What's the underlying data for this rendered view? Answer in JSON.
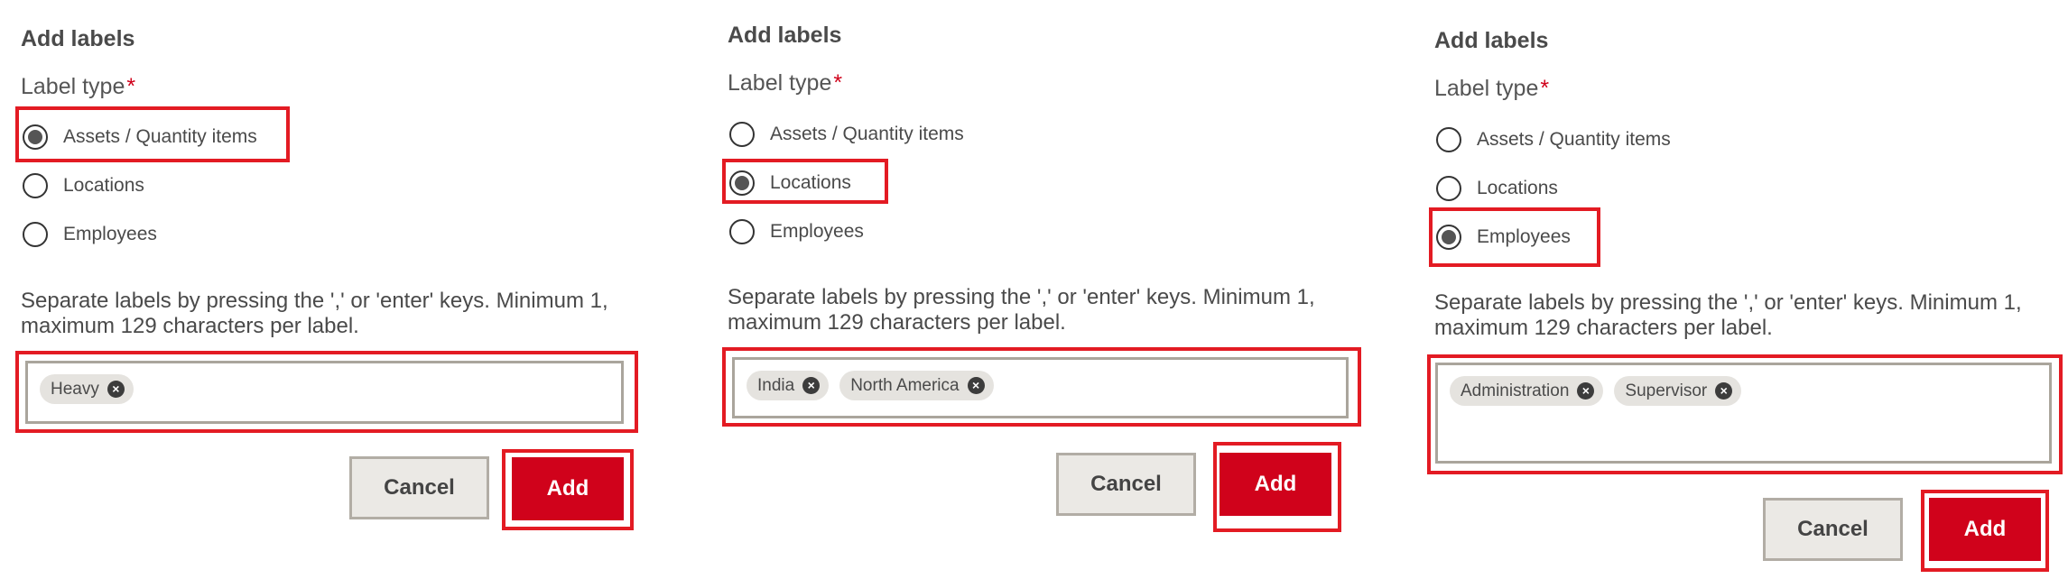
{
  "panels": [
    {
      "title": "Add labels",
      "label_type": "Label type",
      "required_mark": "*",
      "options": [
        "Assets / Quantity items",
        "Locations",
        "Employees"
      ],
      "selected": 0,
      "help": "Separate labels by pressing the ',' or 'enter' keys. Minimum 1, maximum 129 characters per label.",
      "chips": [
        "Heavy"
      ],
      "cancel": "Cancel",
      "add": "Add"
    },
    {
      "title": "Add labels",
      "label_type": "Label type",
      "required_mark": "*",
      "options": [
        "Assets / Quantity items",
        "Locations",
        "Employees"
      ],
      "selected": 1,
      "help": "Separate labels by pressing the ',' or 'enter' keys. Minimum 1, maximum 129 characters per label.",
      "chips": [
        "India",
        "North America"
      ],
      "cancel": "Cancel",
      "add": "Add"
    },
    {
      "title": "Add labels",
      "label_type": "Label type",
      "required_mark": "*",
      "options": [
        "Assets / Quantity items",
        "Locations",
        "Employees"
      ],
      "selected": 2,
      "help": "Separate labels by pressing the ',' or 'enter' keys. Minimum 1, maximum 129 characters per label.",
      "chips": [
        "Administration",
        "Supervisor"
      ],
      "cancel": "Cancel",
      "add": "Add"
    }
  ],
  "colors": {
    "accent": "#d0021b",
    "highlight": "#e31b23"
  }
}
